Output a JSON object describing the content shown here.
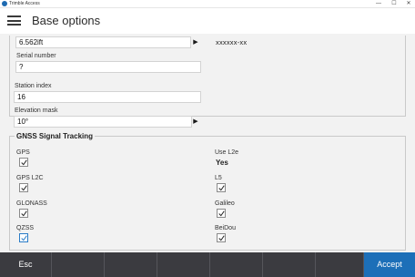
{
  "window": {
    "title": "Trimble Access",
    "minimize": "—",
    "maximize": "☐",
    "close": "✕"
  },
  "header": {
    "title": "Base options"
  },
  "form": {
    "antenna_height": {
      "value": "6.562ift"
    },
    "antenna_side_value": "xxxxxx-xx",
    "serial_number": {
      "label": "Serial number",
      "value": "?"
    },
    "station_index": {
      "label": "Station index",
      "value": "16"
    },
    "elevation_mask": {
      "label": "Elevation mask",
      "value": "10°"
    }
  },
  "gnss": {
    "title": "GNSS Signal Tracking",
    "gps": {
      "label": "GPS",
      "checked": true
    },
    "use_l2e": {
      "label": "Use L2e",
      "value": "Yes"
    },
    "gps_l2c": {
      "label": "GPS L2C",
      "checked": true
    },
    "l5": {
      "label": "L5",
      "checked": true
    },
    "glonass": {
      "label": "GLONASS",
      "checked": true
    },
    "galileo": {
      "label": "Galileo",
      "checked": true
    },
    "qzss": {
      "label": "QZSS",
      "checked": true
    },
    "beidou": {
      "label": "BeiDou",
      "checked": true
    }
  },
  "footer": {
    "esc_label": "Esc",
    "accept_label": "Accept"
  },
  "colors": {
    "accent": "#1c6fb8",
    "footer_bg": "#3b3b40",
    "content_bg": "#f2f2f2"
  },
  "icons": {
    "menu": "hamburger-menu-icon",
    "arrow": "triangle-right-icon",
    "check": "checkmark-icon"
  }
}
